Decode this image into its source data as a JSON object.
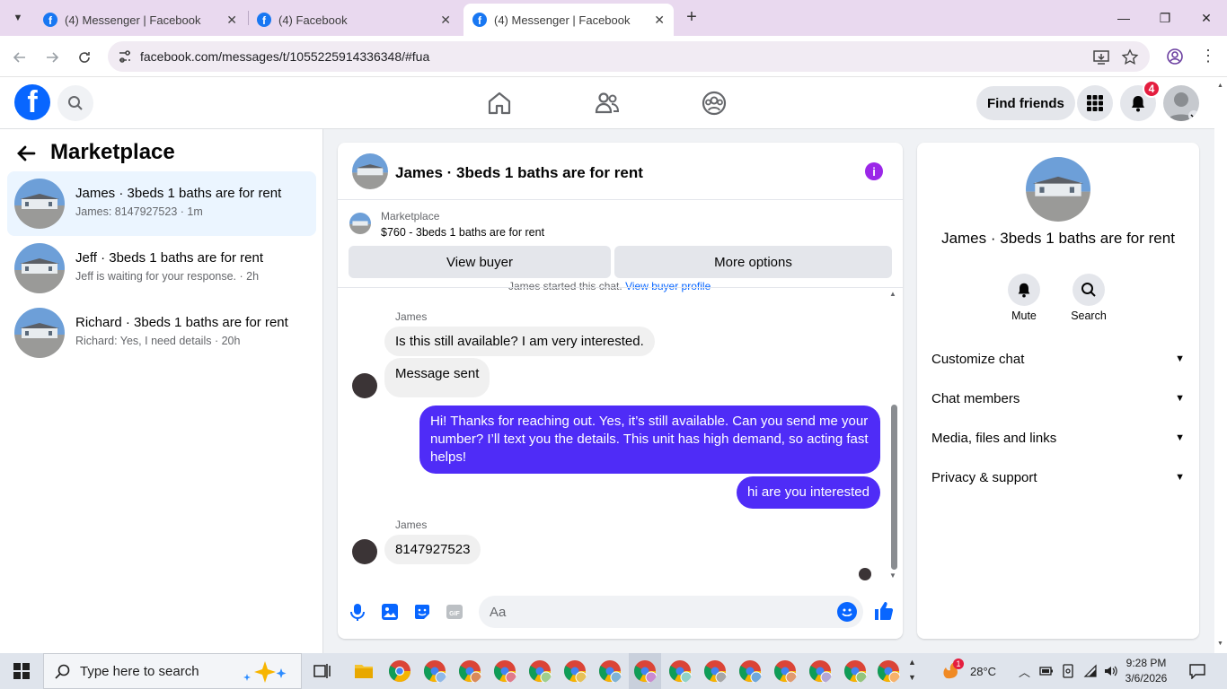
{
  "browser": {
    "tabs": [
      {
        "title": "(4) Messenger | Facebook",
        "active": false
      },
      {
        "title": "(4) Facebook",
        "active": false
      },
      {
        "title": "(4) Messenger | Facebook",
        "active": true
      }
    ],
    "url": "facebook.com/messages/t/1055225914336348/#fua"
  },
  "fbnav": {
    "find_friends": "Find friends",
    "notification_count": "4"
  },
  "left": {
    "title": "Marketplace",
    "conversations": [
      {
        "name": "James · 3beds 1 baths are for rent",
        "preview": "James: 8147927523 · 1m",
        "active": true
      },
      {
        "name": "Jeff · 3beds 1 baths are for rent",
        "preview": "Jeff is waiting for your response. · 2h",
        "active": false
      },
      {
        "name": "Richard · 3beds 1 baths are for rent",
        "preview": "Richard: Yes, I need details · 20h",
        "active": false
      }
    ]
  },
  "chat": {
    "title": "James · 3beds 1 baths are for rent",
    "marketplace_label": "Marketplace",
    "listing": "$760 - 3beds 1 baths are for rent",
    "view_buyer": "View buyer",
    "more_options": "More options",
    "cutoff_text": "James started this chat.",
    "cutoff_link": "View buyer profile",
    "messages": [
      {
        "sender": "James",
        "text": "Is this still available? I am very interested.",
        "dir": "in"
      },
      {
        "text": "Message sent",
        "dir": "in"
      },
      {
        "text": "Hi! Thanks for reaching out. Yes, it’s still available. Can you send me your number? I’ll text you the details. This unit has high demand, so acting fast helps!",
        "dir": "out"
      },
      {
        "text": "hi are you interested",
        "dir": "out"
      },
      {
        "sender": "James",
        "text": "8147927523",
        "dir": "in"
      }
    ],
    "composer_placeholder": "Aa"
  },
  "right": {
    "title": "James · 3beds 1 baths are for rent",
    "mute": "Mute",
    "search": "Search",
    "rows": [
      "Customize chat",
      "Chat members",
      "Media, files and links",
      "Privacy & support"
    ]
  },
  "taskbar": {
    "search_placeholder": "Type here to search",
    "temperature": "28°C",
    "weather_badge": "1",
    "time": "9:28 PM",
    "date": "3/6/2026"
  },
  "colors": {
    "facebook_blue": "#0866ff",
    "outgoing_bubble": "#4f2cf7",
    "info_icon": "#9b27e8",
    "notification_red": "#e41e3f"
  }
}
